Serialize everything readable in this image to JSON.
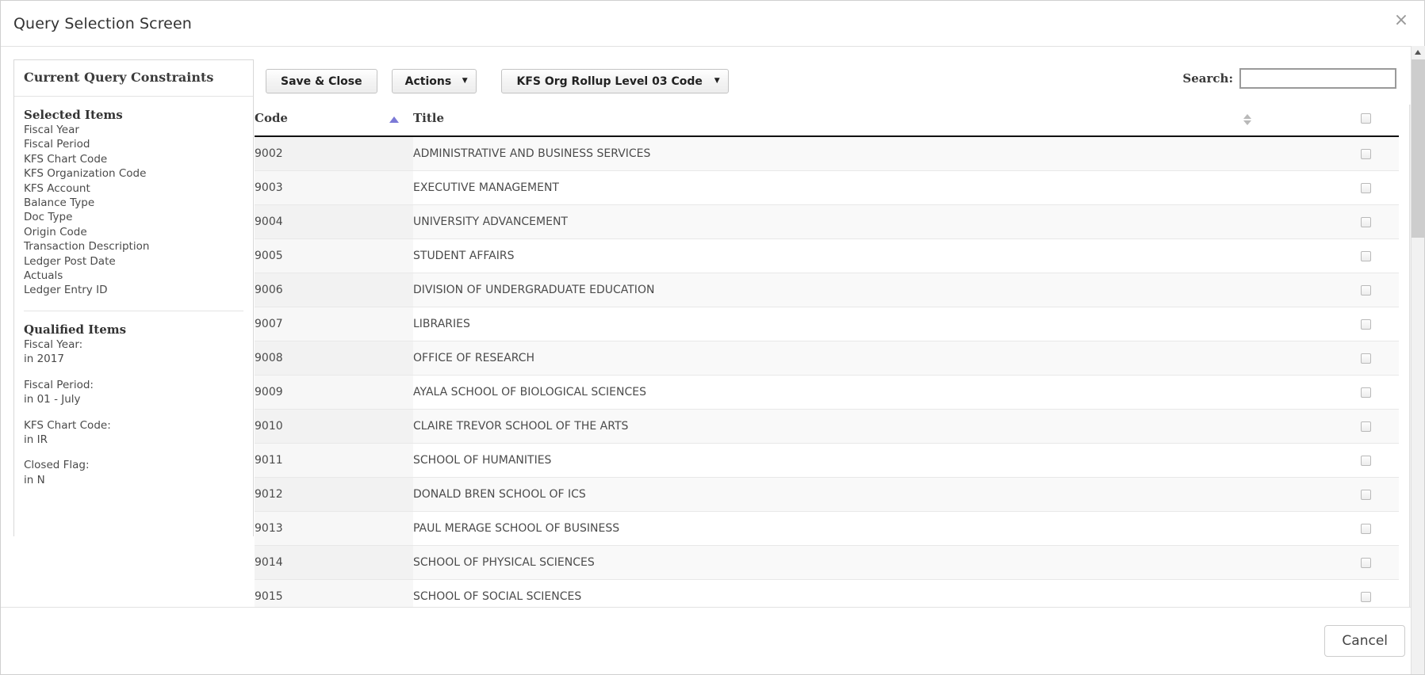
{
  "dialog": {
    "title": "Query Selection Screen",
    "close_icon": "close-icon",
    "close_glyph": "×"
  },
  "left_panel": {
    "header": "Current Query Constraints",
    "selected_items": {
      "title": "Selected Items",
      "items": [
        "Fiscal Year",
        "Fiscal Period",
        "KFS Chart Code",
        "KFS Organization Code",
        "KFS Account",
        "Balance Type",
        "Doc Type",
        "Origin Code",
        "Transaction Description",
        "Ledger Post Date",
        "Actuals",
        "Ledger Entry ID"
      ]
    },
    "qualified_items": {
      "title": "Qualified Items",
      "groups": [
        {
          "label": "Fiscal Year:",
          "value": "in 2017"
        },
        {
          "label": "Fiscal Period:",
          "value": "in 01 - July"
        },
        {
          "label": "KFS Chart Code:",
          "value": "in IR"
        },
        {
          "label": "Closed Flag:",
          "value": "in N"
        }
      ]
    }
  },
  "toolbar": {
    "save_close_label": "Save & Close",
    "actions_label": "Actions",
    "actions_caret": "▼",
    "field_label": "KFS Org Rollup Level 03 Code",
    "field_caret": "▼",
    "search_label": "Search:",
    "search_value": "",
    "search_placeholder": ""
  },
  "table": {
    "columns": {
      "code": "Code",
      "title": "Title",
      "select": ""
    },
    "sort": {
      "column": "Code",
      "direction": "asc",
      "asc_icon": "sort-ascending-icon",
      "both_icon": "sort-both-icon",
      "accent_color": "#7b79d6"
    },
    "rows": [
      {
        "code": "9002",
        "title": "ADMINISTRATIVE AND BUSINESS SERVICES",
        "selected": false
      },
      {
        "code": "9003",
        "title": "EXECUTIVE MANAGEMENT",
        "selected": false
      },
      {
        "code": "9004",
        "title": "UNIVERSITY ADVANCEMENT",
        "selected": false
      },
      {
        "code": "9005",
        "title": "STUDENT AFFAIRS",
        "selected": false
      },
      {
        "code": "9006",
        "title": "DIVISION OF UNDERGRADUATE EDUCATION",
        "selected": false
      },
      {
        "code": "9007",
        "title": "LIBRARIES",
        "selected": false
      },
      {
        "code": "9008",
        "title": "OFFICE OF RESEARCH",
        "selected": false
      },
      {
        "code": "9009",
        "title": "AYALA SCHOOL OF BIOLOGICAL SCIENCES",
        "selected": false
      },
      {
        "code": "9010",
        "title": "CLAIRE TREVOR SCHOOL OF THE ARTS",
        "selected": false
      },
      {
        "code": "9011",
        "title": "SCHOOL OF HUMANITIES",
        "selected": false
      },
      {
        "code": "9012",
        "title": "DONALD BREN SCHOOL OF ICS",
        "selected": false
      },
      {
        "code": "9013",
        "title": "PAUL MERAGE SCHOOL OF BUSINESS",
        "selected": false
      },
      {
        "code": "9014",
        "title": "SCHOOL OF PHYSICAL SCIENCES",
        "selected": false
      },
      {
        "code": "9015",
        "title": "SCHOOL OF SOCIAL SCIENCES",
        "selected": false
      }
    ]
  },
  "scrollbars": {
    "outer": {
      "up_icon": "scroll-up-arrow-icon",
      "down_icon": "scroll-down-arrow-icon"
    },
    "inner": {
      "down_icon": "scroll-down-arrow-icon"
    }
  },
  "footer": {
    "cancel_label": "Cancel"
  }
}
